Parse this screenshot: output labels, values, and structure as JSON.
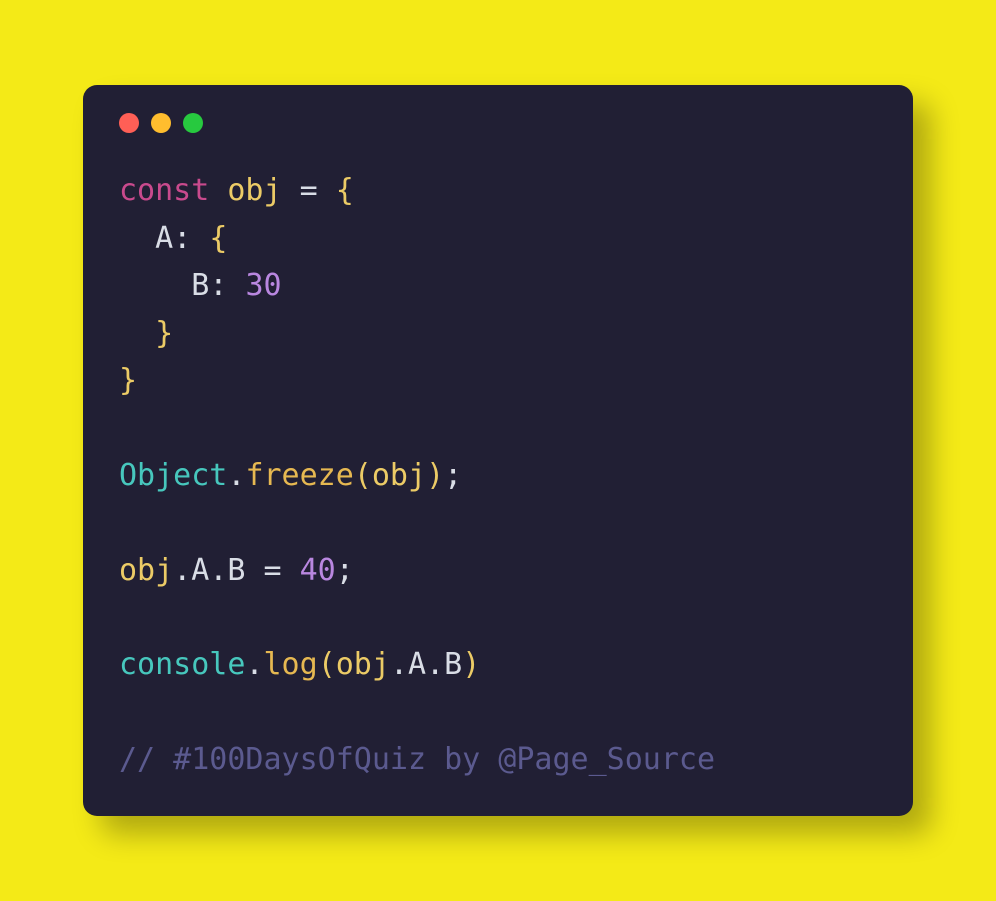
{
  "window": {
    "traffic_lights": {
      "red": "#ff5f56",
      "yellow": "#ffbd2e",
      "green": "#27c93f"
    }
  },
  "code": {
    "line1": {
      "keyword": "const",
      "var": "obj",
      "eq": "=",
      "brace_open": "{"
    },
    "line2": {
      "indent": "  ",
      "prop": "A",
      "colon": ":",
      "brace_open": "{"
    },
    "line3": {
      "indent": "    ",
      "prop": "B",
      "colon": ":",
      "value": "30"
    },
    "line4": {
      "indent": "  ",
      "brace_close": "}"
    },
    "line5": {
      "brace_close": "}"
    },
    "line6": {
      "class": "Object",
      "dot": ".",
      "method": "freeze",
      "paren_open": "(",
      "arg": "obj",
      "paren_close": ")",
      "semi": ";"
    },
    "line7": {
      "var": "obj",
      "dot1": ".",
      "propA": "A",
      "dot2": ".",
      "propB": "B",
      "eq": "=",
      "value": "40",
      "semi": ";"
    },
    "line8": {
      "class": "console",
      "dot": ".",
      "method": "log",
      "paren_open": "(",
      "arg_var": "obj",
      "arg_dot1": ".",
      "arg_propA": "A",
      "arg_dot2": ".",
      "arg_propB": "B",
      "paren_close": ")"
    },
    "comment": "// #100DaysOfQuiz by @Page_Source"
  }
}
